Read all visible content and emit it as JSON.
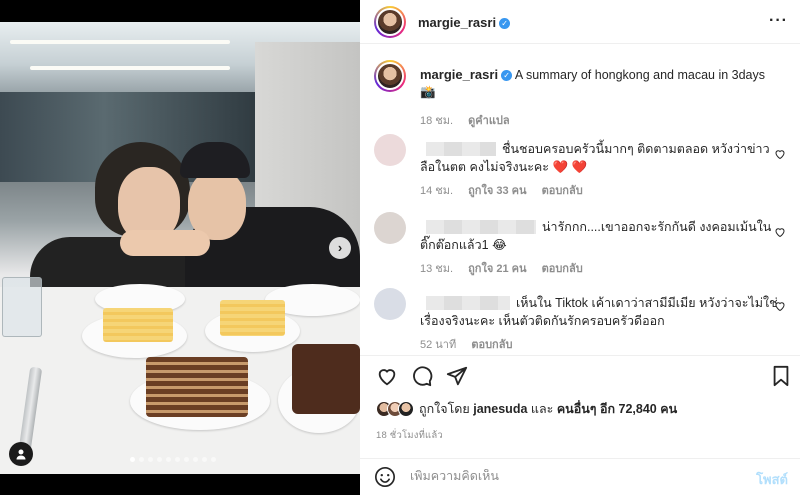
{
  "post": {
    "author": "margie_rasri",
    "caption_text": "A summary of hongkong and macau in 3days",
    "caption_emoji": "📸",
    "caption_age": "18 ชม.",
    "see_translation": "ดูคำแปล"
  },
  "comments": [
    {
      "text": "ชื่นชอบครอบครัวนี้มากๆ ติดตามตลอด หวังว่าข่าวลือในตต คงไม่จริงนะคะ",
      "emoji": "❤️ ❤️",
      "age": "14 ชม.",
      "likes": "ถูกใจ 33 คน",
      "reply": "ตอบกลับ"
    },
    {
      "text": "น่ารักกก....เขาออกจะรักกันดี งงคอมเม้นในติ๊กต๊อกแล้ว1",
      "emoji": "😂",
      "age": "13 ชม.",
      "likes": "ถูกใจ 21 คน",
      "reply": "ตอบกลับ"
    },
    {
      "text": "เห็นใน Tiktok เค้าเดาว่าสามีมีเมีย หวังว่าจะไม่ใช่เรื่องจริงนะคะ เห็นตัวติดกันรักครอบครัวดีออก",
      "emoji": "",
      "age": "52 นาที",
      "likes": "",
      "reply": "ตอบกลับ"
    }
  ],
  "likes": {
    "prefix": "ถูกใจโดย",
    "first_user": "janesuda",
    "middle": "และ",
    "others": "คนอื่นๆ อีก 72,840 คน"
  },
  "post_age": "18 ชั่วโมงที่แล้ว",
  "add_comment": {
    "placeholder": "เพิ่มความคิดเห็น",
    "post_label": "โพสต์"
  },
  "carousel": {
    "slide_count": 10,
    "active_index": 0
  },
  "icons": {
    "more": "more-horizontal-icon",
    "like": "heart-icon",
    "comment": "comment-icon",
    "share": "send-icon",
    "save": "bookmark-icon",
    "emoji": "emoji-icon",
    "next": "chevron-right-icon",
    "tag": "user-tag-icon"
  },
  "colors": {
    "verified": "#3897f0",
    "heart_red": "#ed4956",
    "muted_text": "#8e8e8e",
    "post_button": "#b2dffc"
  }
}
